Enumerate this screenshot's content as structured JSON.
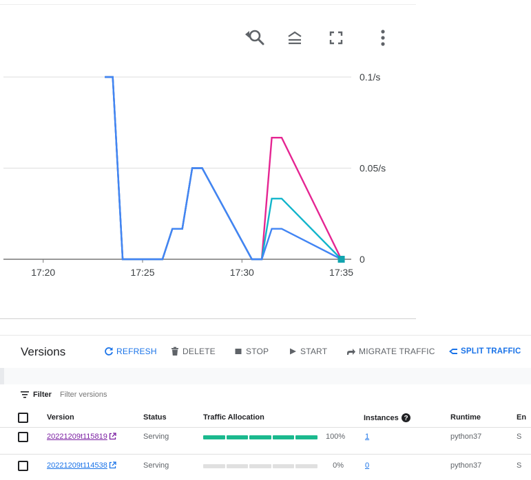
{
  "chart_toolbar": {
    "icons": [
      "reset-zoom-icon",
      "legend-icon",
      "fullscreen-icon",
      "more-vert-icon"
    ]
  },
  "chart_data": {
    "type": "line",
    "x_ticks": [
      "17:20",
      "17:25",
      "17:30",
      "17:35"
    ],
    "y_ticks": [
      "0.1/s",
      "0.05/s",
      "0"
    ],
    "xlim": [
      "17:18",
      "17:35.5"
    ],
    "ylim": [
      0,
      0.1
    ],
    "series": [
      {
        "color": "#e52592",
        "x": [
          "17:23.1",
          "17:23.5",
          "17:24.0",
          "17:25.5",
          "17:26.0",
          "17:26.5",
          "17:27.0",
          "17:27.5",
          "17:28.0",
          "17:30.5",
          "17:31.0",
          "17:31.5",
          "17:32.0",
          "17:35.0"
        ],
        "values": [
          0.1,
          0.1,
          0,
          0,
          0,
          0.0167,
          0.0167,
          0.05,
          0.05,
          0,
          0,
          0.0667,
          0.0667,
          0
        ]
      },
      {
        "color": "#12b5cb",
        "x": [
          "17:23.1",
          "17:23.5",
          "17:24.0",
          "17:25.5",
          "17:26.0",
          "17:26.5",
          "17:27.0",
          "17:27.5",
          "17:28.0",
          "17:30.5",
          "17:31.0",
          "17:31.5",
          "17:32.0",
          "17:35.0"
        ],
        "values": [
          0.1,
          0.1,
          0,
          0,
          0,
          0.0167,
          0.0167,
          0.05,
          0.05,
          0,
          0,
          0.0333,
          0.0333,
          0
        ]
      },
      {
        "color": "#4285f4",
        "x": [
          "17:23.1",
          "17:23.5",
          "17:24.0",
          "17:25.5",
          "17:26.0",
          "17:26.5",
          "17:27.0",
          "17:27.5",
          "17:28.0",
          "17:30.5",
          "17:31.0",
          "17:31.5",
          "17:32.0",
          "17:35.0"
        ],
        "values": [
          0.1,
          0.1,
          0,
          0,
          0,
          0.0167,
          0.0167,
          0.05,
          0.05,
          0,
          0,
          0.0167,
          0.0167,
          0
        ]
      }
    ],
    "marker": {
      "x": "17:35.0",
      "value": 0,
      "color": "#12a4af"
    },
    "grid": true
  },
  "versions": {
    "title": "Versions",
    "actions": {
      "refresh": "REFRESH",
      "delete": "DELETE",
      "stop": "STOP",
      "start": "START",
      "migrate": "MIGRATE TRAFFIC",
      "split": "SPLIT TRAFFIC"
    },
    "filter": {
      "label": "Filter",
      "placeholder": "Filter versions"
    },
    "columns": {
      "version": "Version",
      "status": "Status",
      "traffic": "Traffic Allocation",
      "instances": "Instances",
      "runtime": "Runtime",
      "env": "En"
    },
    "rows": [
      {
        "version": "20221209t115819",
        "status": "Serving",
        "traffic_pct": "100%",
        "traffic_fraction": 1.0,
        "instances": "1",
        "runtime": "python37",
        "env": "S"
      },
      {
        "version": "20221209t114538",
        "status": "Serving",
        "traffic_pct": "0%",
        "traffic_fraction": 0.0,
        "instances": "0",
        "runtime": "python37",
        "env": "S"
      }
    ]
  },
  "colors": {
    "accent_blue": "#1a73e8",
    "traffic_fill": "#1bb98e",
    "traffic_empty": "#e0e0e0",
    "link_visited": "#7b1fa2"
  }
}
